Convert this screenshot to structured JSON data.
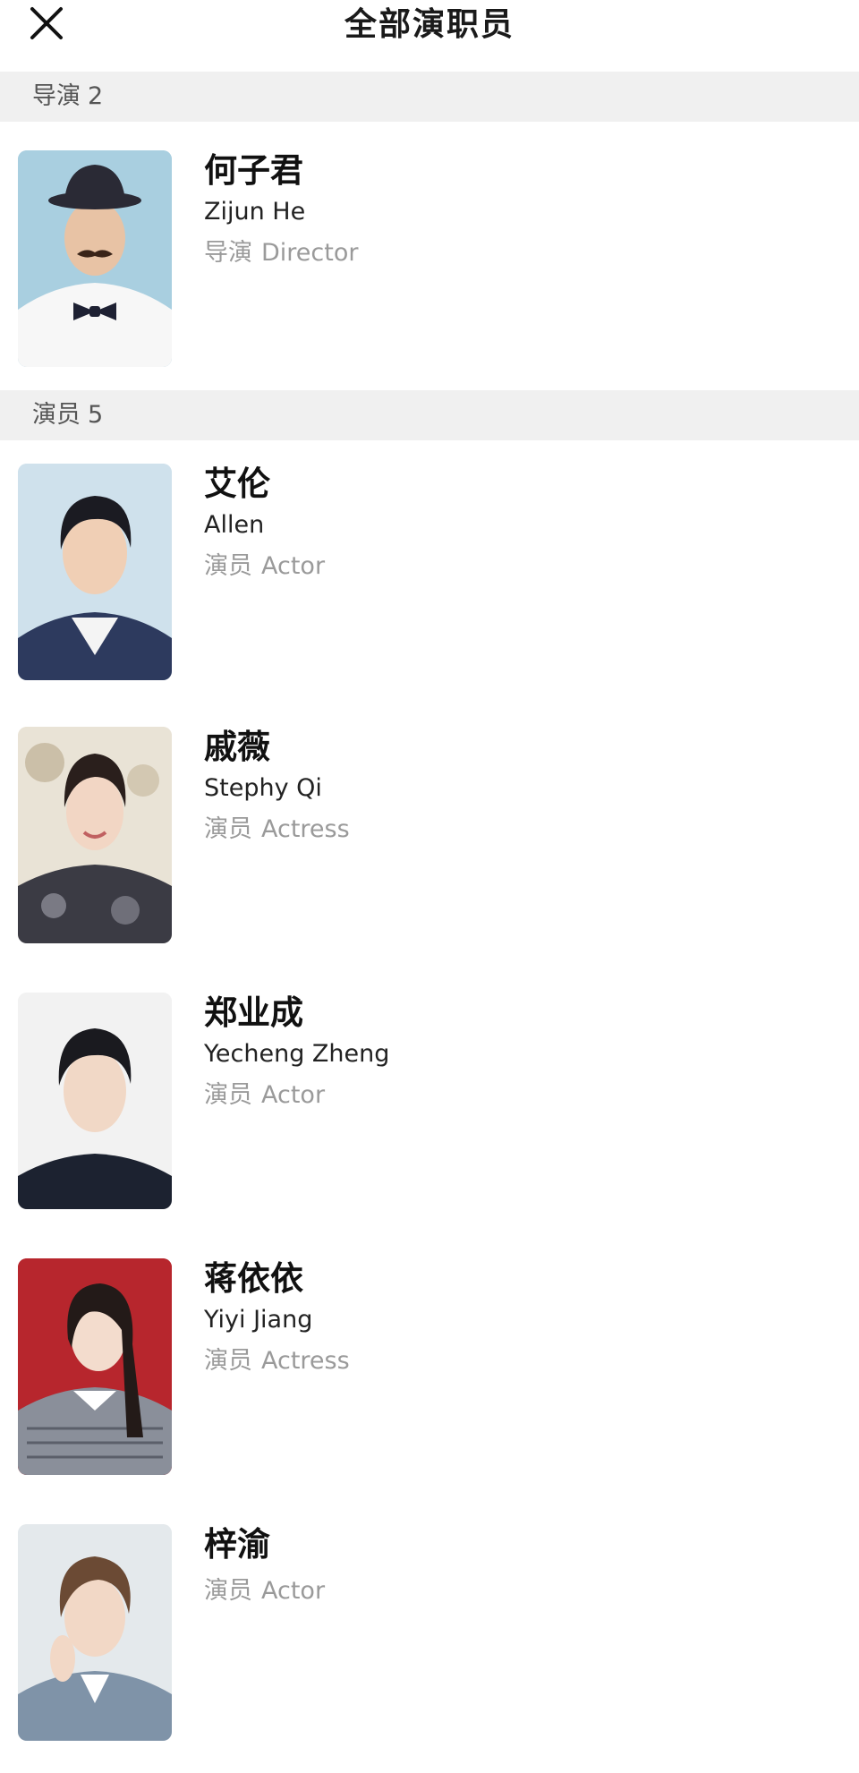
{
  "header": {
    "title": "全部演职员",
    "close_icon": "close-icon"
  },
  "sections": {
    "directors": {
      "label": "导演",
      "count": "2"
    },
    "actors": {
      "label": "演员",
      "count": "5"
    }
  },
  "people": [
    {
      "name_cn": "何子君",
      "name_en": "Zijun He",
      "role_cn": "导演",
      "role_en": "Director",
      "bg": "#a9cfe0"
    },
    {
      "name_cn": "艾伦",
      "name_en": "Allen",
      "role_cn": "演员",
      "role_en": "Actor",
      "bg": "#cfe1ec"
    },
    {
      "name_cn": "戚薇",
      "name_en": "Stephy Qi",
      "role_cn": "演员",
      "role_en": "Actress",
      "bg": "#e9e3d6"
    },
    {
      "name_cn": "郑业成",
      "name_en": "Yecheng Zheng",
      "role_cn": "演员",
      "role_en": "Actor",
      "bg": "#f2f2f2"
    },
    {
      "name_cn": "蒋依依",
      "name_en": "Yiyi Jiang",
      "role_cn": "演员",
      "role_en": "Actress",
      "bg": "#b7262d"
    },
    {
      "name_cn": "梓渝",
      "role_cn": "演员",
      "role_en": "Actor",
      "bg": "#e4e9ec"
    }
  ]
}
